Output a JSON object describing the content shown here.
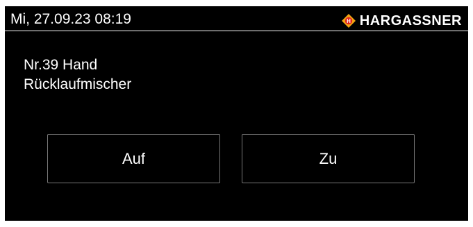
{
  "header": {
    "datetime": "Mi, 27.09.23 08:19",
    "brand": "HARGASSNER",
    "logo_icon": "hargassner-diamond-logo-icon",
    "logo_letter": "H",
    "colors": {
      "logo_outer": "#f2a413",
      "logo_inner": "#e3241d",
      "background": "#000000",
      "text": "#ffffff"
    }
  },
  "info": {
    "line1": "Nr.39 Hand",
    "line2": "Rücklaufmischer"
  },
  "buttons": {
    "open_label": "Auf",
    "close_label": "Zu"
  }
}
